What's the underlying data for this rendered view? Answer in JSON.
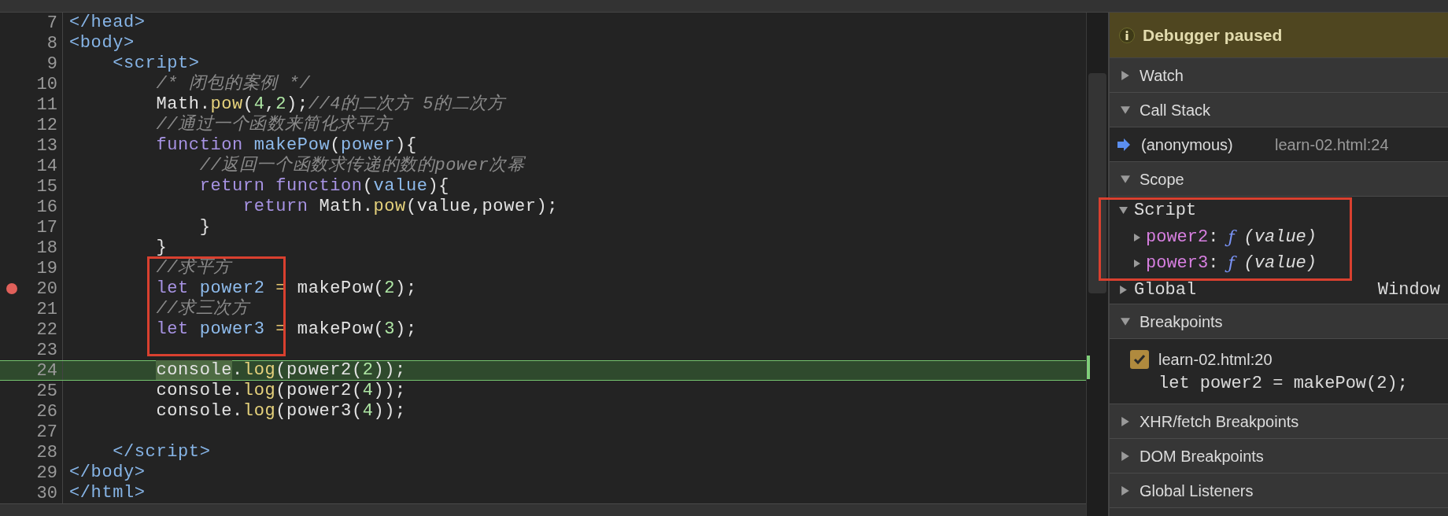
{
  "editor": {
    "lines": [
      {
        "number": "7",
        "breakpoint": false,
        "current": false,
        "tokens": [
          {
            "kind": "tag",
            "text": "</head>"
          }
        ]
      },
      {
        "number": "8",
        "breakpoint": false,
        "current": false,
        "tokens": [
          {
            "kind": "tag",
            "text": "<body>"
          }
        ]
      },
      {
        "number": "9",
        "breakpoint": false,
        "current": false,
        "tokens": [
          {
            "kind": "tag",
            "text": "    <script>"
          }
        ]
      },
      {
        "number": "10",
        "breakpoint": false,
        "current": false,
        "tokens": [
          {
            "kind": "comment",
            "text": "        /* 闭包的案例 */"
          }
        ]
      },
      {
        "number": "11",
        "breakpoint": false,
        "current": false,
        "tokens": [
          {
            "kind": "plain",
            "text": "        Math."
          },
          {
            "kind": "call",
            "text": "pow"
          },
          {
            "kind": "plain",
            "text": "("
          },
          {
            "kind": "number",
            "text": "4"
          },
          {
            "kind": "plain",
            "text": ","
          },
          {
            "kind": "number",
            "text": "2"
          },
          {
            "kind": "plain",
            "text": ");"
          },
          {
            "kind": "comment",
            "text": "//4的二次方 5的二次方"
          }
        ]
      },
      {
        "number": "12",
        "breakpoint": false,
        "current": false,
        "tokens": [
          {
            "kind": "comment",
            "text": "        //通过一个函数来简化求平方"
          }
        ]
      },
      {
        "number": "13",
        "breakpoint": false,
        "current": false,
        "tokens": [
          {
            "kind": "keyword",
            "text": "        function"
          },
          {
            "kind": "name",
            "text": " makePow"
          },
          {
            "kind": "plain",
            "text": "("
          },
          {
            "kind": "name",
            "text": "power"
          },
          {
            "kind": "plain",
            "text": "){"
          }
        ]
      },
      {
        "number": "14",
        "breakpoint": false,
        "current": false,
        "tokens": [
          {
            "kind": "comment",
            "text": "            //返回一个函数求传递的数的power次幂"
          }
        ]
      },
      {
        "number": "15",
        "breakpoint": false,
        "current": false,
        "tokens": [
          {
            "kind": "keyword",
            "text": "            return function"
          },
          {
            "kind": "plain",
            "text": "("
          },
          {
            "kind": "name",
            "text": "value"
          },
          {
            "kind": "plain",
            "text": "){"
          }
        ]
      },
      {
        "number": "16",
        "breakpoint": false,
        "current": false,
        "tokens": [
          {
            "kind": "keyword",
            "text": "                return"
          },
          {
            "kind": "plain",
            "text": " Math."
          },
          {
            "kind": "call",
            "text": "pow"
          },
          {
            "kind": "plain",
            "text": "(value,power);"
          }
        ]
      },
      {
        "number": "17",
        "breakpoint": false,
        "current": false,
        "tokens": [
          {
            "kind": "plain",
            "text": "            }"
          }
        ]
      },
      {
        "number": "18",
        "breakpoint": false,
        "current": false,
        "tokens": [
          {
            "kind": "plain",
            "text": "        }"
          }
        ]
      },
      {
        "number": "19",
        "breakpoint": false,
        "current": false,
        "tokens": [
          {
            "kind": "comment",
            "text": "        //求平方"
          }
        ]
      },
      {
        "number": "20",
        "breakpoint": true,
        "current": false,
        "tokens": [
          {
            "kind": "keyword",
            "text": "        let"
          },
          {
            "kind": "name",
            "text": " power2"
          },
          {
            "kind": "operator",
            "text": " ="
          },
          {
            "kind": "plain",
            "text": " makePow("
          },
          {
            "kind": "number",
            "text": "2"
          },
          {
            "kind": "plain",
            "text": ");"
          }
        ]
      },
      {
        "number": "21",
        "breakpoint": false,
        "current": false,
        "tokens": [
          {
            "kind": "comment",
            "text": "        //求三次方"
          }
        ]
      },
      {
        "number": "22",
        "breakpoint": false,
        "current": false,
        "tokens": [
          {
            "kind": "keyword",
            "text": "        let"
          },
          {
            "kind": "name",
            "text": " power3"
          },
          {
            "kind": "operator",
            "text": " ="
          },
          {
            "kind": "plain",
            "text": " makePow("
          },
          {
            "kind": "number",
            "text": "3"
          },
          {
            "kind": "plain",
            "text": ");"
          }
        ]
      },
      {
        "number": "23",
        "breakpoint": false,
        "current": false
      },
      {
        "number": "24",
        "breakpoint": false,
        "current": true,
        "tokens": [
          {
            "kind": "paused",
            "text": "        console"
          },
          {
            "kind": "plain",
            "text": "."
          },
          {
            "kind": "call",
            "text": "log"
          },
          {
            "kind": "plain",
            "text": "(power2("
          },
          {
            "kind": "number",
            "text": "2"
          },
          {
            "kind": "plain",
            "text": "));"
          }
        ]
      },
      {
        "number": "25",
        "breakpoint": false,
        "current": false,
        "tokens": [
          {
            "kind": "plain",
            "text": "        console."
          },
          {
            "kind": "call",
            "text": "log"
          },
          {
            "kind": "plain",
            "text": "(power2("
          },
          {
            "kind": "number",
            "text": "4"
          },
          {
            "kind": "plain",
            "text": "));"
          }
        ]
      },
      {
        "number": "26",
        "breakpoint": false,
        "current": false,
        "tokens": [
          {
            "kind": "plain",
            "text": "        console."
          },
          {
            "kind": "call",
            "text": "log"
          },
          {
            "kind": "plain",
            "text": "(power3("
          },
          {
            "kind": "number",
            "text": "4"
          },
          {
            "kind": "plain",
            "text": "));"
          }
        ]
      },
      {
        "number": "27",
        "breakpoint": false,
        "current": false
      },
      {
        "number": "28",
        "breakpoint": false,
        "current": false,
        "tokens": [
          {
            "kind": "tag",
            "text": "    </script>"
          }
        ]
      },
      {
        "number": "29",
        "breakpoint": false,
        "current": false,
        "tokens": [
          {
            "kind": "tag",
            "text": "</body>"
          }
        ]
      },
      {
        "number": "30",
        "breakpoint": false,
        "current": false,
        "tokens": [
          {
            "kind": "tag",
            "text": "</html>"
          }
        ]
      }
    ]
  },
  "debugger": {
    "banner": "Debugger paused",
    "sections": [
      {
        "kind": "plain",
        "title": "Watch",
        "expanded": false
      },
      {
        "kind": "callstack",
        "title": "Call Stack",
        "expanded": true,
        "frames": [
          {
            "name": "(anonymous)",
            "location": "learn-02.html:24",
            "selected": true
          }
        ]
      },
      {
        "kind": "scope",
        "title": "Scope",
        "expanded": true,
        "scopes": [
          {
            "name": "Script",
            "expanded": true,
            "properties": [
              {
                "name": "power2",
                "separator": ":",
                "type": "ƒ",
                "value": "(value)",
                "expanded": false
              },
              {
                "name": "power3",
                "separator": ":",
                "type": "ƒ",
                "value": "(value)",
                "expanded": false
              }
            ]
          },
          {
            "name": "Global",
            "expanded": false,
            "value": "Window"
          }
        ]
      },
      {
        "kind": "breakpoints",
        "title": "Breakpoints",
        "expanded": true,
        "breakpoints": [
          {
            "location": "learn-02.html:20",
            "code": "let power2 = makePow(2);",
            "checked": true
          }
        ]
      },
      {
        "kind": "plain",
        "title": "XHR/fetch Breakpoints",
        "expanded": false
      },
      {
        "kind": "plain",
        "title": "DOM Breakpoints",
        "expanded": false
      },
      {
        "kind": "plain",
        "title": "Global Listeners",
        "expanded": false
      }
    ]
  }
}
